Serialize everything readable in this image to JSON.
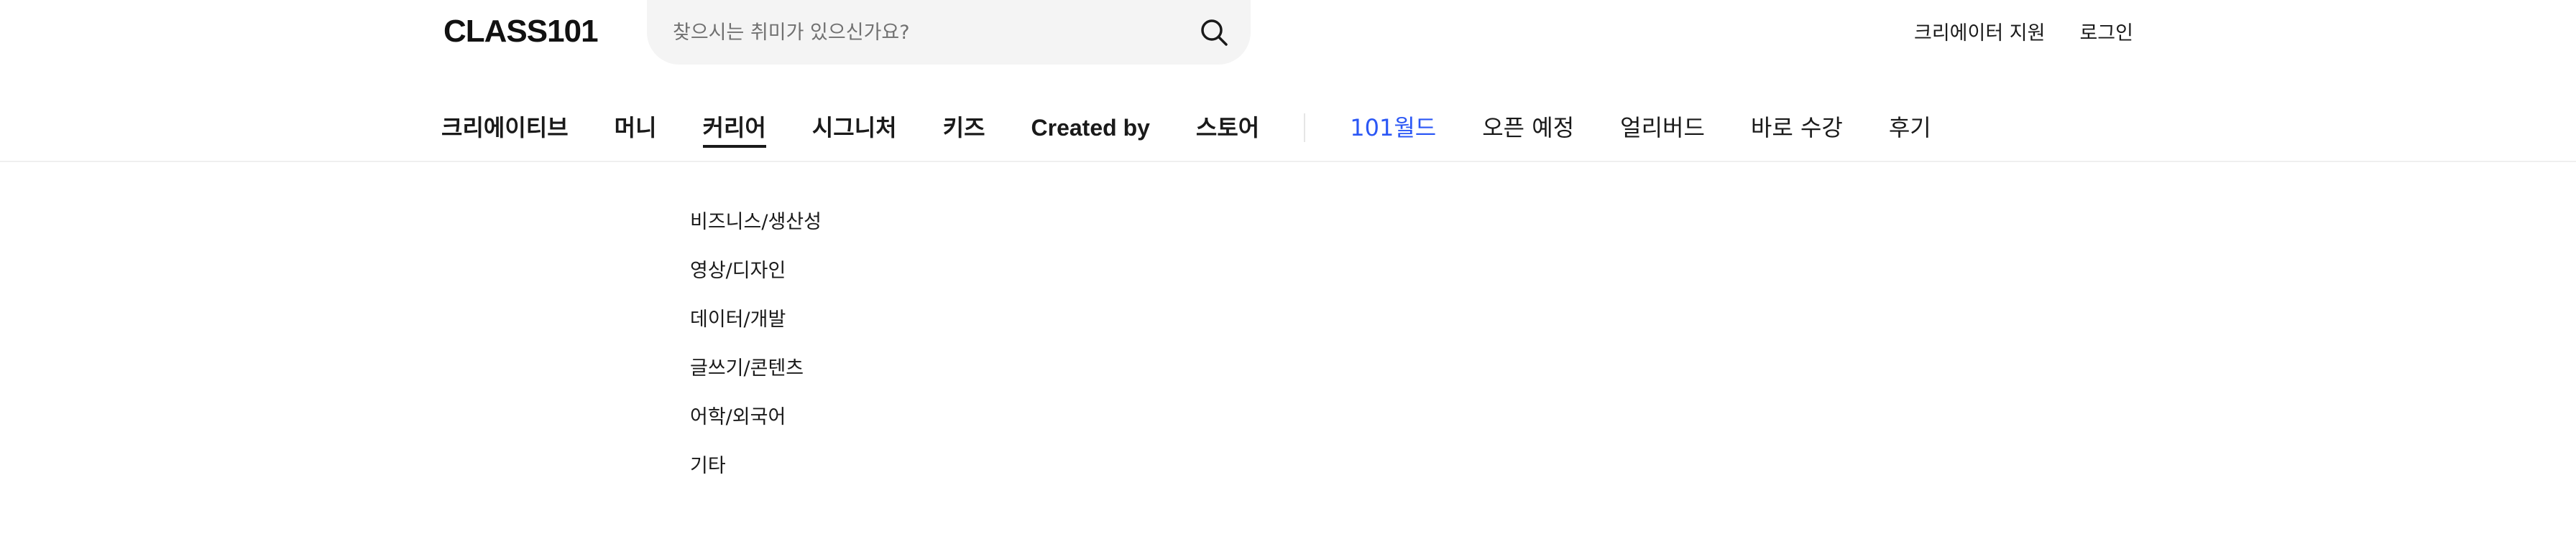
{
  "header": {
    "logo": "CLASS101",
    "search": {
      "placeholder": "찾으시는 취미가 있으신가요?",
      "value": "",
      "icon": "search-icon"
    },
    "top_links": [
      {
        "label": "크리에이터 지원"
      },
      {
        "label": "로그인"
      }
    ]
  },
  "nav": {
    "primary": [
      {
        "label": "크리에이티브"
      },
      {
        "label": "머니"
      },
      {
        "label": "커리어",
        "active": true
      },
      {
        "label": "시그니처"
      },
      {
        "label": "키즈"
      },
      {
        "label": "Created by"
      },
      {
        "label": "스토어"
      }
    ],
    "secondary": [
      {
        "label": "101월드",
        "color": "#2b57f5"
      },
      {
        "label": "오픈 예정"
      },
      {
        "label": "얼리버드"
      },
      {
        "label": "바로 수강"
      },
      {
        "label": "후기"
      }
    ]
  },
  "dropdown": {
    "items": [
      {
        "label": "비즈니스/생산성"
      },
      {
        "label": "영상/디자인"
      },
      {
        "label": "데이터/개발"
      },
      {
        "label": "글쓰기/콘텐츠"
      },
      {
        "label": "어학/외국어"
      },
      {
        "label": "기타"
      }
    ]
  },
  "colors": {
    "accent": "#2b57f5",
    "text": "#1a1a1a",
    "search_bg": "#f4f4f4",
    "divider": "#efefef"
  }
}
